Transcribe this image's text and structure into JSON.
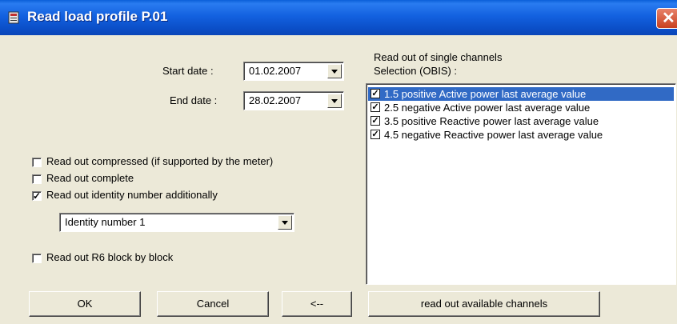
{
  "window": {
    "title": "Read load profile P.01",
    "close_glyph": "✕"
  },
  "dates": {
    "start_label": "Start date :",
    "start_value": "01.02.2007",
    "end_label": "End date :",
    "end_value": "28.02.2007"
  },
  "options": [
    {
      "label": "Read out compressed (if supported by the meter)",
      "checked": false
    },
    {
      "label": "Read out complete",
      "checked": false
    },
    {
      "label": "Read out identity number additionally",
      "checked": true
    }
  ],
  "identity_select": {
    "value": "Identity number 1"
  },
  "r6_option": {
    "label": "Read out R6 block by block",
    "checked": false
  },
  "channels": {
    "heading": "Read out of single channels",
    "selection_label": "Selection (OBIS) :",
    "items": [
      {
        "label": "1.5 positive Active power last average value",
        "checked": true,
        "selected": true
      },
      {
        "label": "2.5 negative Active power last average value",
        "checked": true,
        "selected": false
      },
      {
        "label": "3.5 positive Reactive power last average value",
        "checked": true,
        "selected": false
      },
      {
        "label": "4.5 negative Reactive power last average value",
        "checked": true,
        "selected": false
      }
    ]
  },
  "buttons": {
    "ok": "OK",
    "cancel": "Cancel",
    "back": "<--",
    "read_channels": "read out available channels"
  },
  "colors": {
    "titlebar": "#0b4fc8",
    "selection": "#316ac5",
    "dialog_bg": "#ece9d8"
  }
}
